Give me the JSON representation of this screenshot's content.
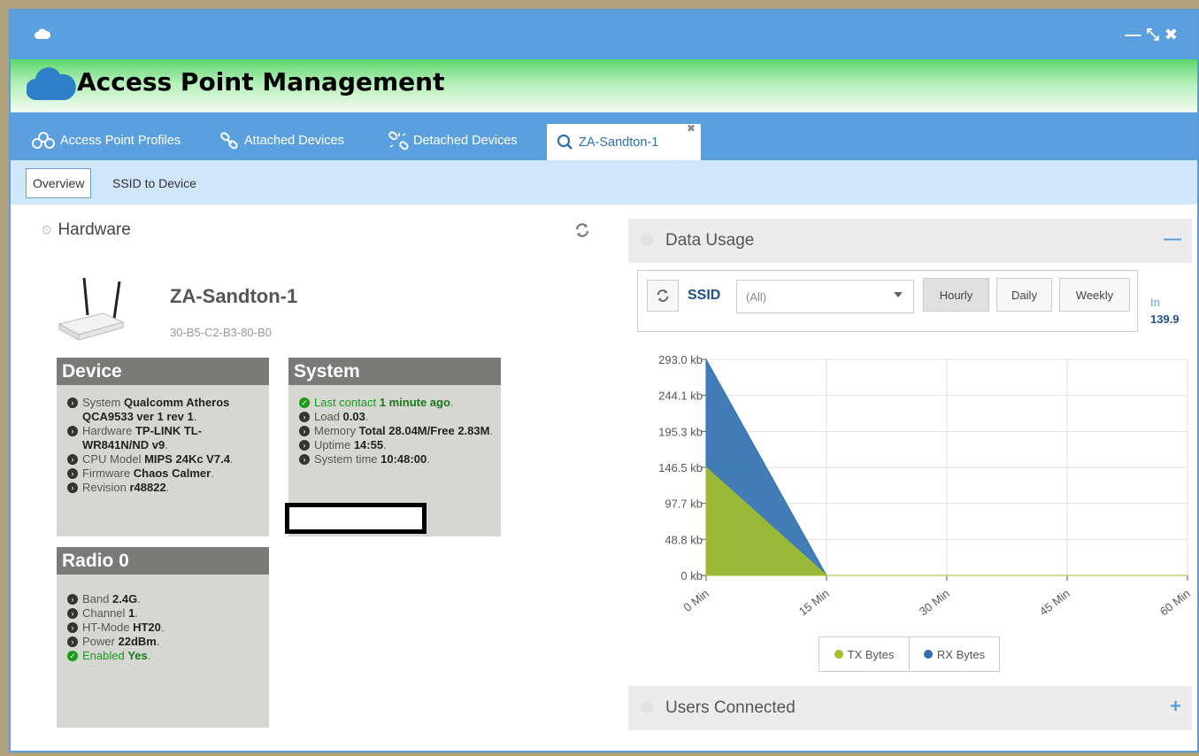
{
  "app": {
    "title": "Access Point Management"
  },
  "tabs": [
    {
      "label": "Access Point Profiles"
    },
    {
      "label": "Attached Devices"
    },
    {
      "label": "Detached Devices"
    },
    {
      "label": "ZA-Sandton-1"
    }
  ],
  "subtabs": [
    {
      "label": "Overview"
    },
    {
      "label": "SSID to Device"
    }
  ],
  "hardware": {
    "title": "Hardware",
    "device_name": "ZA-Sandton-1",
    "device_mac": "30-B5-C2-B3-80-B0"
  },
  "device_box": {
    "title": "Device",
    "items": [
      {
        "label": "System",
        "value": "Qualcomm Atheros QCA9533 ver 1 rev 1"
      },
      {
        "label": "Hardware",
        "value": "TP-LINK TL-WR841N/ND v9"
      },
      {
        "label": "CPU Model",
        "value": "MIPS 24Kc V7.4"
      },
      {
        "label": "Firmware",
        "value": "Chaos Calmer"
      },
      {
        "label": "Revision",
        "value": "r48822"
      }
    ]
  },
  "system_box": {
    "title": "System",
    "items": [
      {
        "label": "Last contact",
        "value": "1 minute ago"
      },
      {
        "label": "Load",
        "value": "0.03"
      },
      {
        "label": "Memory",
        "value": "Total 28.04M/Free 2.83M"
      },
      {
        "label": "Uptime",
        "value": "14:55"
      },
      {
        "label": "System time",
        "value": "10:48:00"
      }
    ]
  },
  "radio_box": {
    "title": "Radio 0",
    "items": [
      {
        "label": "Band",
        "value": "2.4G"
      },
      {
        "label": "Channel",
        "value": "1"
      },
      {
        "label": "HT-Mode",
        "value": "HT20"
      },
      {
        "label": "Power",
        "value": "22dBm"
      },
      {
        "label": "Enabled",
        "value": "Yes"
      }
    ]
  },
  "data_usage": {
    "title": "Data Usage",
    "collapse_symbol": "—",
    "ssid_label": "SSID",
    "ssid_value": "(All)",
    "buttons": [
      "Hourly",
      "Daily",
      "Weekly"
    ],
    "in_label": "In",
    "in_value": "139.9"
  },
  "users_connected": {
    "title": "Users Connected",
    "expand_symbol": "+"
  },
  "colors": {
    "tx": "#a4bf2a",
    "rx": "#2e6fb0",
    "accent": "#5ba0de"
  },
  "chart_data": {
    "type": "area",
    "x": [
      "0 Min",
      "15 Min",
      "30 Min",
      "45 Min",
      "60 Min"
    ],
    "y_ticks": [
      "0 kb",
      "48.8 kb",
      "97.7 kb",
      "146.5 kb",
      "195.3 kb",
      "244.1 kb",
      "293.0 kb"
    ],
    "ylim": [
      0,
      293.0
    ],
    "grid": true,
    "legend": "bottom",
    "series": [
      {
        "name": "TX Bytes",
        "values": [
          146.5,
          0,
          0,
          0,
          0
        ]
      },
      {
        "name": "RX Bytes",
        "values": [
          293.0,
          0,
          0,
          0,
          0
        ]
      }
    ]
  }
}
